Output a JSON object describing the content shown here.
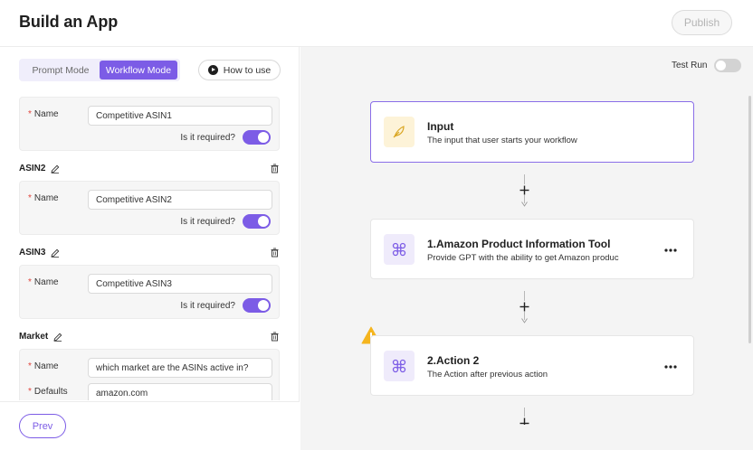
{
  "header": {
    "title": "Build an App",
    "publish_label": "Publish"
  },
  "left": {
    "modes": {
      "prompt_label": "Prompt Mode",
      "workflow_label": "Workflow Mode",
      "active": "Workflow Mode"
    },
    "how_to_label": "How to use",
    "fields": [
      {
        "section": "",
        "name_label": "Name",
        "name_value": "Competitive ASIN1",
        "required_label": "Is it required?",
        "required": true
      },
      {
        "section": "ASIN2",
        "name_label": "Name",
        "name_value": "Competitive ASIN2",
        "required_label": "Is it required?",
        "required": true
      },
      {
        "section": "ASIN3",
        "name_label": "Name",
        "name_value": "Competitive ASIN3",
        "required_label": "Is it required?",
        "required": true
      },
      {
        "section": "Market",
        "name_label": "Name",
        "name_value": "which market are the ASINs active in?",
        "defaults_label": "Defaults",
        "defaults_value": "amazon.com"
      }
    ],
    "prev_label": "Prev"
  },
  "canvas": {
    "test_run_label": "Test Run",
    "test_run_on": false,
    "nodes": [
      {
        "title": "Input",
        "description": "The input that user starts your workflow",
        "icon": "feather-icon",
        "selected": true
      },
      {
        "title": "1.Amazon Product Information Tool",
        "description": "Provide GPT with the ability to get Amazon produc",
        "icon": "command-icon"
      },
      {
        "title": "2.Action 2",
        "description": "The Action after previous action",
        "icon": "command-icon",
        "warning": true
      }
    ]
  },
  "colors": {
    "accent": "#7c5ce6",
    "warning": "#f5b51e",
    "canvas_bg": "#f4f4f4"
  }
}
